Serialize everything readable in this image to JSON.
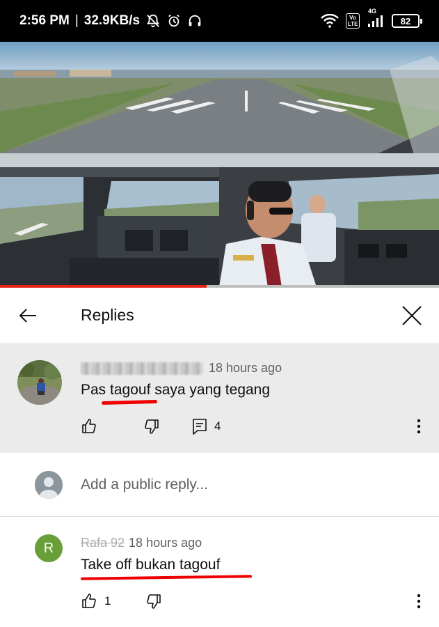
{
  "status_bar": {
    "time": "2:56 PM",
    "separator": "|",
    "net_speed": "32.9KB/s",
    "network_label": "4G",
    "volte_label": "Vo LTE",
    "battery": "82"
  },
  "video": {
    "progress_fraction": 0.47,
    "progress_color": "#e62117"
  },
  "replies_panel": {
    "title": "Replies"
  },
  "parent_comment": {
    "time": "18 hours ago",
    "text": "Pas tagouf saya yang tegang",
    "reply_count": "4",
    "bg_color": "#ebebeb"
  },
  "add_reply": {
    "placeholder": "Add a public reply..."
  },
  "reply": {
    "avatar_letter": "R",
    "name": "Rafa 92",
    "time": "18 hours ago",
    "text": "Take off bukan tagouf",
    "like_count": "1",
    "avatar_color": "#689f38"
  },
  "icons": [
    "back-arrow-icon",
    "close-icon",
    "thumbs-up-icon",
    "thumbs-down-icon",
    "reply-comment-icon",
    "more-vert-icon",
    "wifi-icon",
    "alarm-icon",
    "headphones-icon",
    "notifications-off-icon",
    "signal-icon"
  ]
}
